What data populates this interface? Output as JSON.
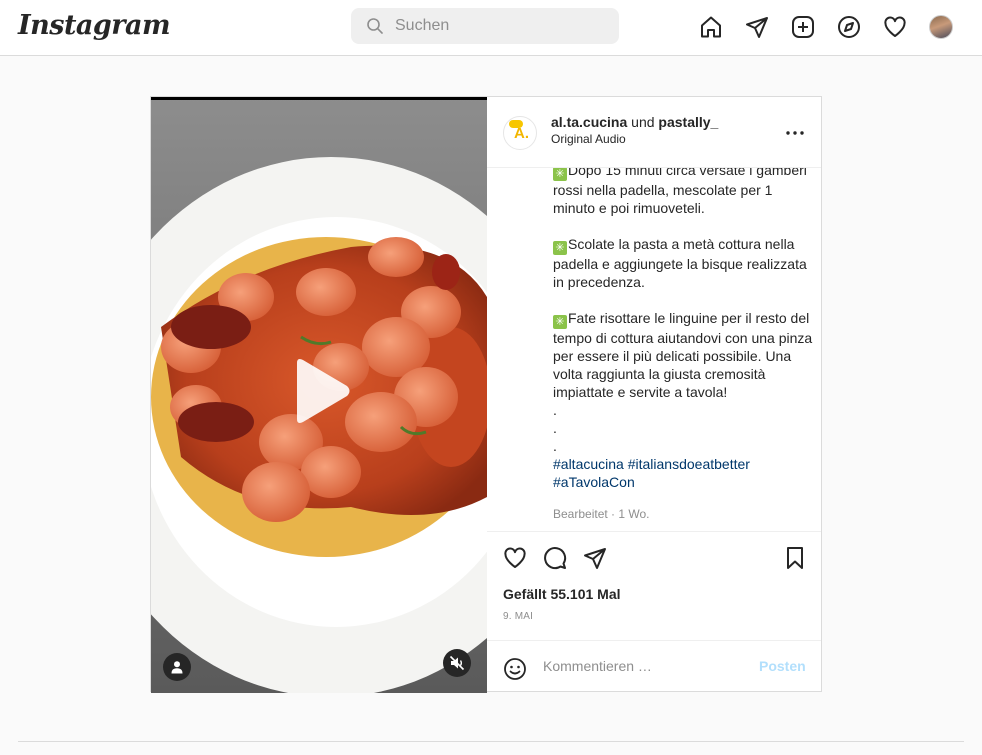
{
  "topbar": {
    "logo": "Instagram",
    "search_placeholder": "Suchen",
    "icons": [
      "home-icon",
      "direct-icon",
      "new-post-icon",
      "explore-icon",
      "activity-icon",
      "profile-avatar"
    ]
  },
  "post": {
    "header": {
      "user1": "al.ta.cucina",
      "connector": "und",
      "user2": "pastally_",
      "audio": "Original Audio",
      "avatar_letter": "A."
    },
    "caption": {
      "p1": "Dopo 15 minuti circa versate i gamberi rossi nella padella, mescolate per 1 minuto e poi rimuoveteli.",
      "p2": "Scolate la pasta a metà cottura nella padella e aggiungete la bisque realizzata in precedenza.",
      "p3": "Fate risottare le linguine per il resto del tempo di cottura aiutandovi con una pinza per essere il più delicati possibile. Una volta raggiunta la giusta cremosità impiattate e servite a tavola!",
      "dots": [
        ".",
        ".",
        "."
      ],
      "hashtags": [
        "#altacucina",
        "#italiansdoeatbetter",
        "#aTavolaCon"
      ],
      "edited": "Bearbeitet · 1 Wo."
    },
    "likes": "Gefällt 55.101 Mal",
    "date": "9. MAI",
    "comment_placeholder": "Kommentieren …",
    "post_button": "Posten"
  },
  "colors": {
    "link": "#00376b",
    "post_button_disabled": "#b2dffc",
    "border": "#dbdbdb",
    "herb_badge": "#8bc34a"
  }
}
